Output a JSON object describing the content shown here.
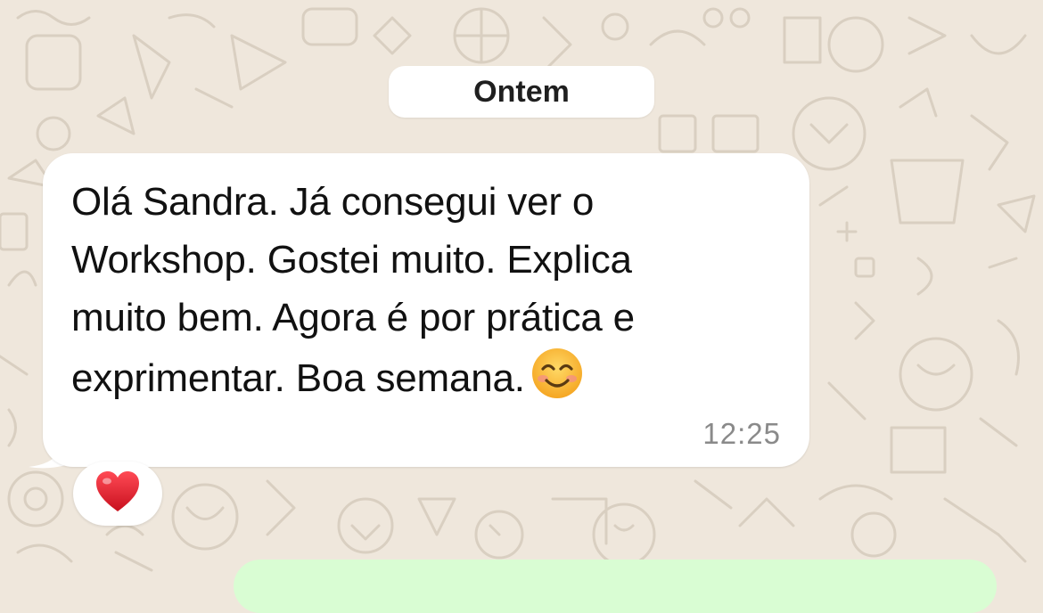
{
  "chat": {
    "date_separator": "Ontem",
    "incoming_message": {
      "lines": [
        "Olá Sandra. Já consegui ver o",
        "Workshop. Gostei muito. Explica",
        "muito bem. Agora é por prática e",
        "exprimentar. Boa semana."
      ],
      "inline_emoji": "smiling-face-with-smiling-eyes-emoji",
      "time": "12:25",
      "reaction": "red-heart-emoji"
    },
    "outgoing_message": {
      "partially_visible": true
    }
  },
  "colors": {
    "wallpaper": "#efe7dc",
    "doodle": "#d9cfc1",
    "incoming_bubble": "#ffffff",
    "outgoing_bubble": "#d9fdd3",
    "timestamp": "#8a8a8a",
    "heart": "#e0202e",
    "emoji_face": "#ffc83d"
  }
}
